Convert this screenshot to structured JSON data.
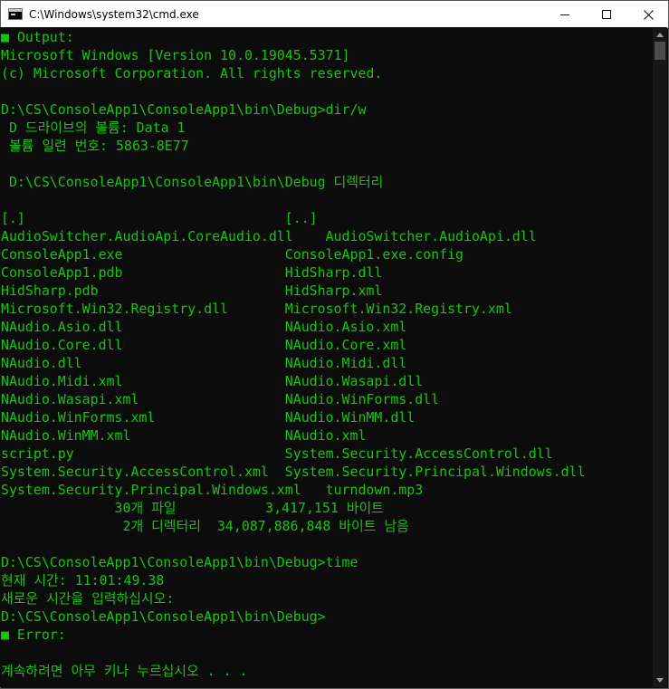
{
  "window": {
    "title": "C:\\Windows\\system32\\cmd.exe",
    "icon": "cmd-icon",
    "controls": {
      "minimize": "minimize-icon",
      "maximize": "maximize-icon",
      "close": "close-icon"
    }
  },
  "console": {
    "colors": {
      "text": "#16c60c",
      "background": "#0c0c0c"
    },
    "lines": [
      "■ Output:",
      "Microsoft Windows [Version 10.0.19045.5371]",
      "(c) Microsoft Corporation. All rights reserved.",
      "",
      "D:\\CS\\ConsoleApp1\\ConsoleApp1\\bin\\Debug>dir/w",
      " D 드라이브의 볼륨: Data 1",
      " 볼륨 일련 번호: 5863-8E77",
      "",
      " D:\\CS\\ConsoleApp1\\ConsoleApp1\\bin\\Debug 디렉터리",
      "",
      "[.]                                [..]",
      "AudioSwitcher.AudioApi.CoreAudio.dll    AudioSwitcher.AudioApi.dll",
      "ConsoleApp1.exe                    ConsoleApp1.exe.config",
      "ConsoleApp1.pdb                    HidSharp.dll",
      "HidSharp.pdb                       HidSharp.xml",
      "Microsoft.Win32.Registry.dll       Microsoft.Win32.Registry.xml",
      "NAudio.Asio.dll                    NAudio.Asio.xml",
      "NAudio.Core.dll                    NAudio.Core.xml",
      "NAudio.dll                         NAudio.Midi.dll",
      "NAudio.Midi.xml                    NAudio.Wasapi.dll",
      "NAudio.Wasapi.xml                  NAudio.WinForms.dll",
      "NAudio.WinForms.xml                NAudio.WinMM.dll",
      "NAudio.WinMM.xml                   NAudio.xml",
      "script.py                          System.Security.AccessControl.dll",
      "System.Security.AccessControl.xml  System.Security.Principal.Windows.dll",
      "System.Security.Principal.Windows.xml   turndown.mp3",
      "              30개 파일           3,417,151 바이트",
      "               2개 디렉터리  34,087,886,848 바이트 남음",
      "",
      "D:\\CS\\ConsoleApp1\\ConsoleApp1\\bin\\Debug>time",
      "현재 시간: 11:01:49.38",
      "새로운 시간을 입력하십시오:",
      "D:\\CS\\ConsoleApp1\\ConsoleApp1\\bin\\Debug>",
      "■ Error:",
      "",
      "계속하려면 아무 키나 누르십시오 . . ."
    ]
  },
  "scrollbar": {
    "up": "scroll-up-arrow-icon",
    "down": "scroll-down-arrow-icon"
  }
}
